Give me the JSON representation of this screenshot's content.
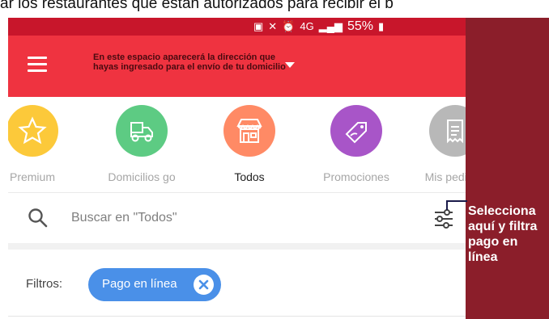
{
  "doc_caption": "ar los restaurantes que están autorizados para recibir el b",
  "status_bar": {
    "network": "4G",
    "battery": "55%"
  },
  "app_bar": {
    "address_text": "En este espacio aparecerá la dirección que hayas ingresado para el envío de tu domicilio"
  },
  "categories": [
    {
      "label": "Premium",
      "color": "#fcc93a",
      "icon": "star-icon"
    },
    {
      "label": "Domicilios go",
      "color": "#5dcb83",
      "icon": "delivery-scooter-icon"
    },
    {
      "label": "Todos",
      "color": "#ff8a65",
      "icon": "store-icon",
      "active": true
    },
    {
      "label": "Promociones",
      "color": "#a855c8",
      "icon": "tag-icon"
    },
    {
      "label": "Mis pedidos",
      "color": "#b8b8b8",
      "icon": "receipt-icon"
    }
  ],
  "search": {
    "placeholder": "Buscar en \"Todos\""
  },
  "filters": {
    "label": "Filtros:",
    "chip_label": "Pago en línea"
  },
  "annotation": {
    "text": "Selecciona aquí y filtra pago en línea"
  },
  "colors": {
    "app_bar": "#ef3340",
    "status_bar": "#c8162b",
    "chip": "#4a90e8",
    "side_panel": "#8b1e2a"
  }
}
